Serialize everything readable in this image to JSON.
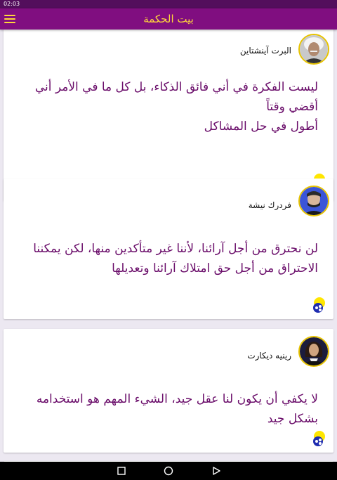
{
  "status_bar": {
    "time": "02:03"
  },
  "app_bar": {
    "title": "بيت الحكمة",
    "menu_icon": "hamburger-icon"
  },
  "quotes": [
    {
      "author": "البرت آينشتاين",
      "lines": [
        "ليست الفكرة في أني فائق الذكاء، بل كل ما في الأمر أني أقضي وقتاً",
        "أطول في حل المشاكل"
      ]
    },
    {
      "author": "فردرك نيشة",
      "lines": [
        "لن نحترق من أجل آرائنا، لأننا غير متأكدين منها، لكن يمكننا",
        "الاحتراق من أجل حق امتلاك آرائنا وتعديلها"
      ]
    },
    {
      "author": "رينيه ديكارت",
      "lines": [
        "لا يكفي أن يكون لنا عقل جيد، الشيء المهم هو استخدامه بشكل جيد"
      ]
    }
  ],
  "colors": {
    "app_bar": "#800e80",
    "status_bar": "#530e5c",
    "title": "#ffd63a",
    "quote_text": "#6a0d6a",
    "background": "#ece8f1"
  },
  "nav_bar": {
    "icons": [
      "back-icon",
      "home-icon",
      "recents-icon"
    ]
  }
}
